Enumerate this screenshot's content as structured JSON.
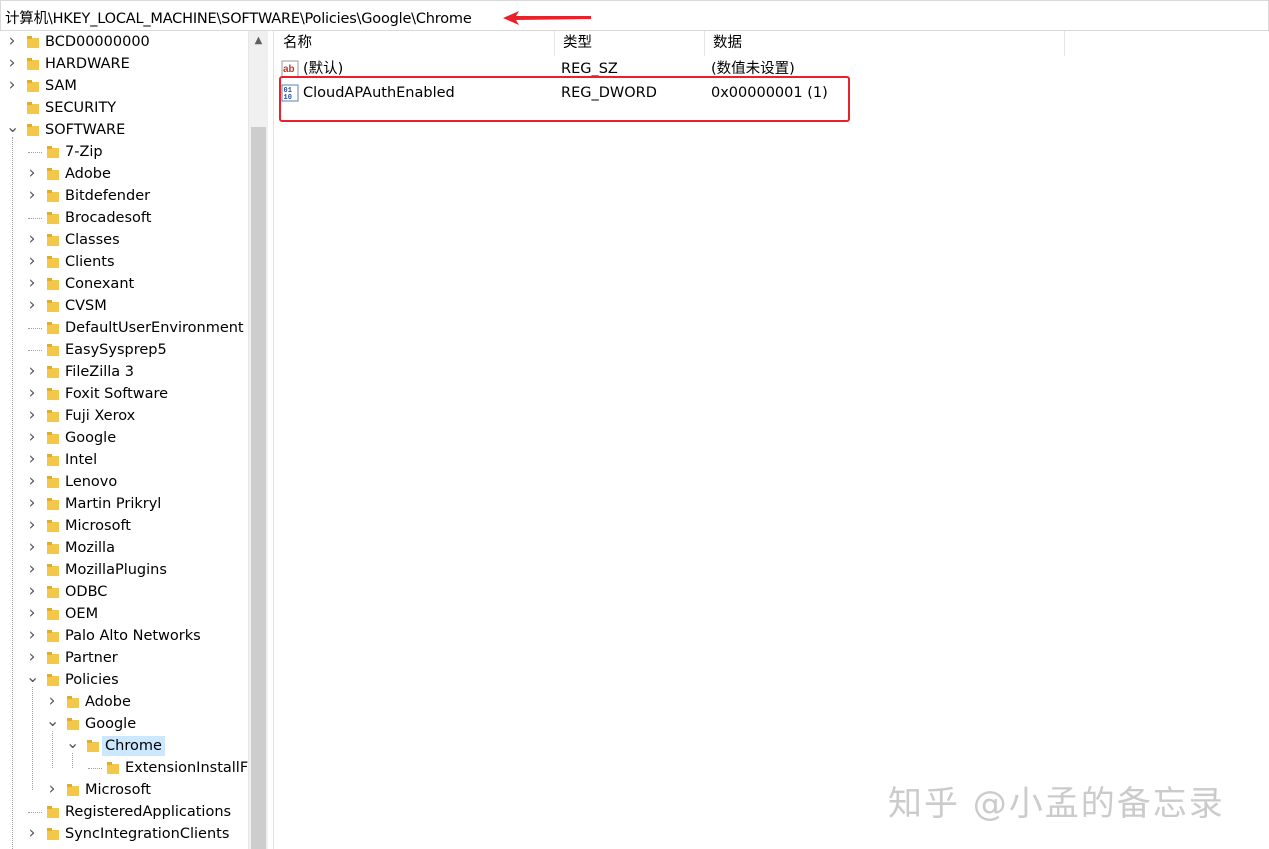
{
  "address_bar": {
    "path": "计算机\\HKEY_LOCAL_MACHINE\\SOFTWARE\\Policies\\Google\\Chrome"
  },
  "tree": {
    "items": [
      {
        "label": "BCD00000000",
        "level": 0,
        "expander": "collapsed"
      },
      {
        "label": "HARDWARE",
        "level": 0,
        "expander": "collapsed"
      },
      {
        "label": "SAM",
        "level": 0,
        "expander": "collapsed"
      },
      {
        "label": "SECURITY",
        "level": 0,
        "expander": "none"
      },
      {
        "label": "SOFTWARE",
        "level": 0,
        "expander": "expanded"
      },
      {
        "label": "7-Zip",
        "level": 1,
        "expander": "none"
      },
      {
        "label": "Adobe",
        "level": 1,
        "expander": "collapsed"
      },
      {
        "label": "Bitdefender",
        "level": 1,
        "expander": "collapsed"
      },
      {
        "label": "Brocadesoft",
        "level": 1,
        "expander": "none"
      },
      {
        "label": "Classes",
        "level": 1,
        "expander": "collapsed"
      },
      {
        "label": "Clients",
        "level": 1,
        "expander": "collapsed"
      },
      {
        "label": "Conexant",
        "level": 1,
        "expander": "collapsed"
      },
      {
        "label": "CVSM",
        "level": 1,
        "expander": "collapsed"
      },
      {
        "label": "DefaultUserEnvironment",
        "level": 1,
        "expander": "none"
      },
      {
        "label": "EasySysprep5",
        "level": 1,
        "expander": "none"
      },
      {
        "label": "FileZilla 3",
        "level": 1,
        "expander": "collapsed"
      },
      {
        "label": "Foxit Software",
        "level": 1,
        "expander": "collapsed"
      },
      {
        "label": "Fuji Xerox",
        "level": 1,
        "expander": "collapsed"
      },
      {
        "label": "Google",
        "level": 1,
        "expander": "collapsed"
      },
      {
        "label": "Intel",
        "level": 1,
        "expander": "collapsed"
      },
      {
        "label": "Lenovo",
        "level": 1,
        "expander": "collapsed"
      },
      {
        "label": "Martin Prikryl",
        "level": 1,
        "expander": "collapsed"
      },
      {
        "label": "Microsoft",
        "level": 1,
        "expander": "collapsed"
      },
      {
        "label": "Mozilla",
        "level": 1,
        "expander": "collapsed"
      },
      {
        "label": "MozillaPlugins",
        "level": 1,
        "expander": "collapsed"
      },
      {
        "label": "ODBC",
        "level": 1,
        "expander": "collapsed"
      },
      {
        "label": "OEM",
        "level": 1,
        "expander": "collapsed"
      },
      {
        "label": "Palo Alto Networks",
        "level": 1,
        "expander": "collapsed"
      },
      {
        "label": "Partner",
        "level": 1,
        "expander": "collapsed"
      },
      {
        "label": "Policies",
        "level": 1,
        "expander": "expanded"
      },
      {
        "label": "Adobe",
        "level": 2,
        "expander": "collapsed"
      },
      {
        "label": "Google",
        "level": 2,
        "expander": "expanded"
      },
      {
        "label": "Chrome",
        "level": 3,
        "expander": "expanded",
        "selected": true
      },
      {
        "label": "ExtensionInstallF",
        "level": 4,
        "expander": "none"
      },
      {
        "label": "Microsoft",
        "level": 2,
        "expander": "collapsed"
      },
      {
        "label": "RegisteredApplications",
        "level": 1,
        "expander": "none"
      },
      {
        "label": "SyncIntegrationClients",
        "level": 1,
        "expander": "collapsed"
      }
    ]
  },
  "values_pane": {
    "columns": {
      "name": "名称",
      "type": "类型",
      "data": "数据"
    },
    "rows": [
      {
        "name": "(默认)",
        "type": "REG_SZ",
        "data": "(数值未设置)",
        "icon": "string-value-icon"
      },
      {
        "name": "CloudAPAuthEnabled",
        "type": "REG_DWORD",
        "data": "0x00000001 (1)",
        "icon": "dword-value-icon"
      }
    ]
  },
  "annotations": {
    "highlight_color": "#e8212b",
    "arrow_color": "#e8212b"
  },
  "watermark": {
    "text": "知乎 @小孟的备忘录"
  },
  "colors": {
    "folder": "#f3c84a",
    "selection": "#cce8ff"
  }
}
